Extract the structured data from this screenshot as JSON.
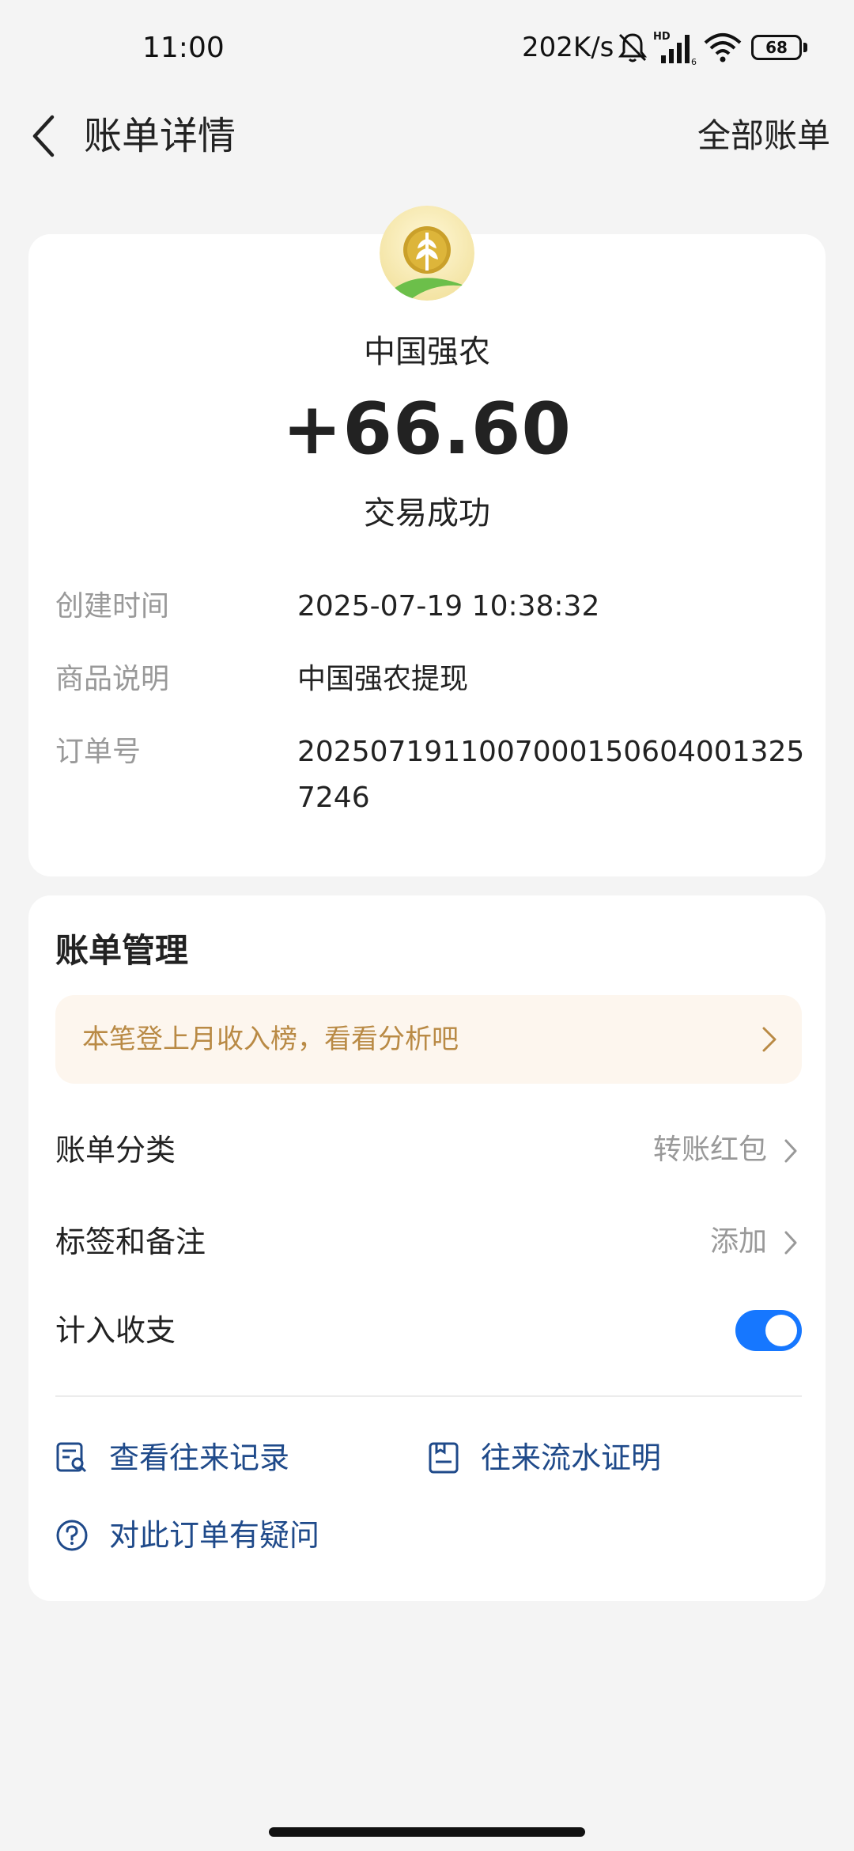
{
  "status_bar": {
    "time": "11:00",
    "net_speed": "202K/s",
    "signal_badge": "HD",
    "signal_sub": "6",
    "battery": "68",
    "icons": [
      "bell-off-icon",
      "signal-icon",
      "wifi-icon",
      "battery-icon"
    ]
  },
  "nav": {
    "title": "账单详情",
    "right_link": "全部账单",
    "back_icon": "chevron-left-icon"
  },
  "summary": {
    "merchant_name": "中国强农",
    "logo_icon": "wheat-logo-icon",
    "amount": "+66.60",
    "status": "交易成功",
    "details": [
      {
        "label": "创建时间",
        "value": "2025-07-19 10:38:32"
      },
      {
        "label": "商品说明",
        "value": "中国强农提现"
      },
      {
        "label": "订单号",
        "value": "20250719110070001506040013257246"
      }
    ]
  },
  "manage": {
    "title": "账单管理",
    "promo": "本笔登上月收入榜，看看分析吧",
    "category_label": "账单分类",
    "category_value": "转账红包",
    "tags_label": "标签和备注",
    "tags_value": "添加",
    "include_label": "计入收支",
    "include_enabled": true,
    "actions": {
      "history": "查看往来记录",
      "proof": "往来流水证明",
      "question": "对此订单有疑问"
    }
  },
  "colors": {
    "accent_blue": "#1677ff",
    "link_blue": "#1f4a8a",
    "promo_text": "#b98a45",
    "promo_bg": "#fdf6ee",
    "background": "#f4f4f4"
  }
}
